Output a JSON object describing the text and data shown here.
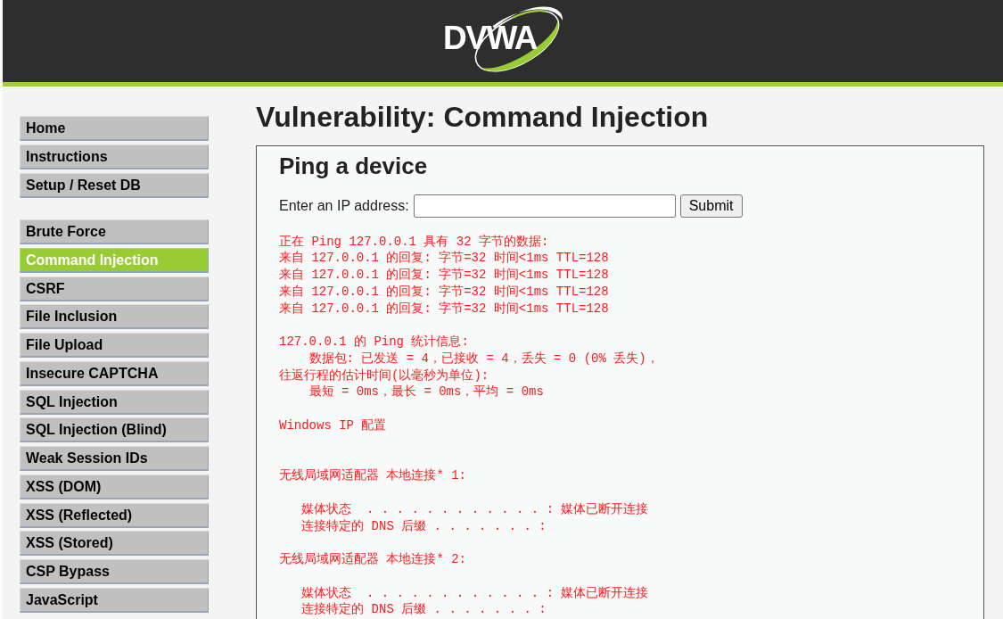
{
  "header": {
    "logo": "DVWA"
  },
  "menu": [
    {
      "items": [
        {
          "label": "Home",
          "selected": false
        },
        {
          "label": "Instructions",
          "selected": false
        },
        {
          "label": "Setup / Reset DB",
          "selected": false
        }
      ]
    },
    {
      "items": [
        {
          "label": "Brute Force",
          "selected": false
        },
        {
          "label": "Command Injection",
          "selected": true
        },
        {
          "label": "CSRF",
          "selected": false
        },
        {
          "label": "File Inclusion",
          "selected": false
        },
        {
          "label": "File Upload",
          "selected": false
        },
        {
          "label": "Insecure CAPTCHA",
          "selected": false
        },
        {
          "label": "SQL Injection",
          "selected": false
        },
        {
          "label": "SQL Injection (Blind)",
          "selected": false
        },
        {
          "label": "Weak Session IDs",
          "selected": false
        },
        {
          "label": "XSS (DOM)",
          "selected": false
        },
        {
          "label": "XSS (Reflected)",
          "selected": false
        },
        {
          "label": "XSS (Stored)",
          "selected": false
        },
        {
          "label": "CSP Bypass",
          "selected": false
        },
        {
          "label": "JavaScript",
          "selected": false
        }
      ]
    }
  ],
  "page_title": "Vulnerability: Command Injection",
  "panel": {
    "heading": "Ping a device",
    "ip_label": "Enter an IP address:",
    "submit_button": "Submit",
    "output": {
      "ping_lines": [
        "正在 Ping 127.0.0.1 具有 32 字节的数据:",
        "来自 127.0.0.1 的回复: 字节=32 时间<1ms TTL=128",
        "来自 127.0.0.1 的回复: 字节=32 时间<1ms TTL=128",
        "来自 127.0.0.1 的回复: 字节=32 时间<1ms TTL=128",
        "来自 127.0.0.1 的回复: 字节=32 时间<1ms TTL=128"
      ],
      "statistics_lines": [
        "127.0.0.1 的 Ping 统计信息:",
        "    数据包: 已发送 = 4，已接收 = 4，丢失 = 0 (0% 丢失)，",
        "往返行程的估计时间(以毫秒为单位):",
        "    最短 = 0ms，最长 = 0ms，平均 = 0ms"
      ],
      "ipconfig": {
        "title": "Windows IP 配置",
        "adapters": [
          {
            "heading": "无线局域网适配器 本地连接* 1:",
            "lines": [
              "   媒体状态  . . . . . . . . . . . . : 媒体已断开连接",
              "   连接特定的 DNS 后缀 . . . . . . . :"
            ]
          },
          {
            "heading": "无线局域网适配器 本地连接* 2:",
            "lines": [
              "   媒体状态  . . . . . . . . . . . . : 媒体已断开连接",
              "   连接特定的 DNS 后缀 . . . . . . . :"
            ]
          }
        ]
      }
    }
  }
}
